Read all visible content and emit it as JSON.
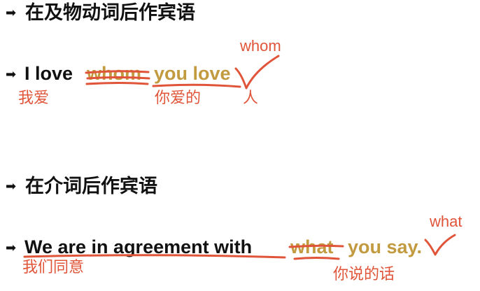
{
  "section1": {
    "bullet": "➡",
    "heading": "在及物动词后作宾语",
    "example": {
      "prefix": "I love",
      "struck_word": "whom",
      "clause": "you love",
      "annotation_above": "whom",
      "label_prefix": "我爱",
      "label_clause": "你爱的",
      "label_inserted": "人"
    }
  },
  "section2": {
    "bullet": "➡",
    "heading": "在介词后作宾语",
    "example": {
      "prefix": "We are in agreement with",
      "struck_word": "what",
      "clause": "you say.",
      "annotation_above": "what",
      "label_prefix": "我们同意",
      "label_clause": "你说的话"
    }
  },
  "colors": {
    "text": "#111111",
    "highlight": "#c29a3f",
    "ink": "#e0553a"
  }
}
